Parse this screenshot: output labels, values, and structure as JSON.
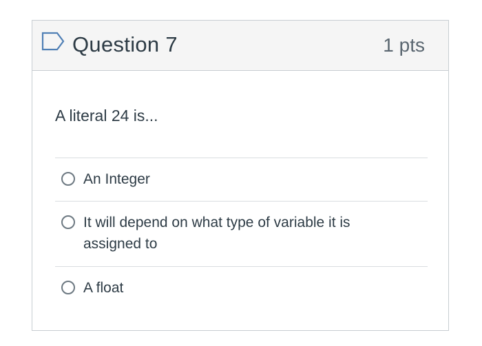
{
  "question": {
    "title": "Question 7",
    "points": "1 pts",
    "text": "A literal 24 is...",
    "answers": [
      {
        "label": "An Integer",
        "selected": false
      },
      {
        "label": "It will depend on what type of variable it is assigned to",
        "selected": false
      },
      {
        "label": "A float",
        "selected": false
      }
    ]
  },
  "icons": {
    "flag": "flag-outline-icon"
  },
  "colors": {
    "accent": "#4f7fb5",
    "text": "#2d3b45",
    "header_bg": "#f5f5f5",
    "border": "#c7cdd1"
  }
}
